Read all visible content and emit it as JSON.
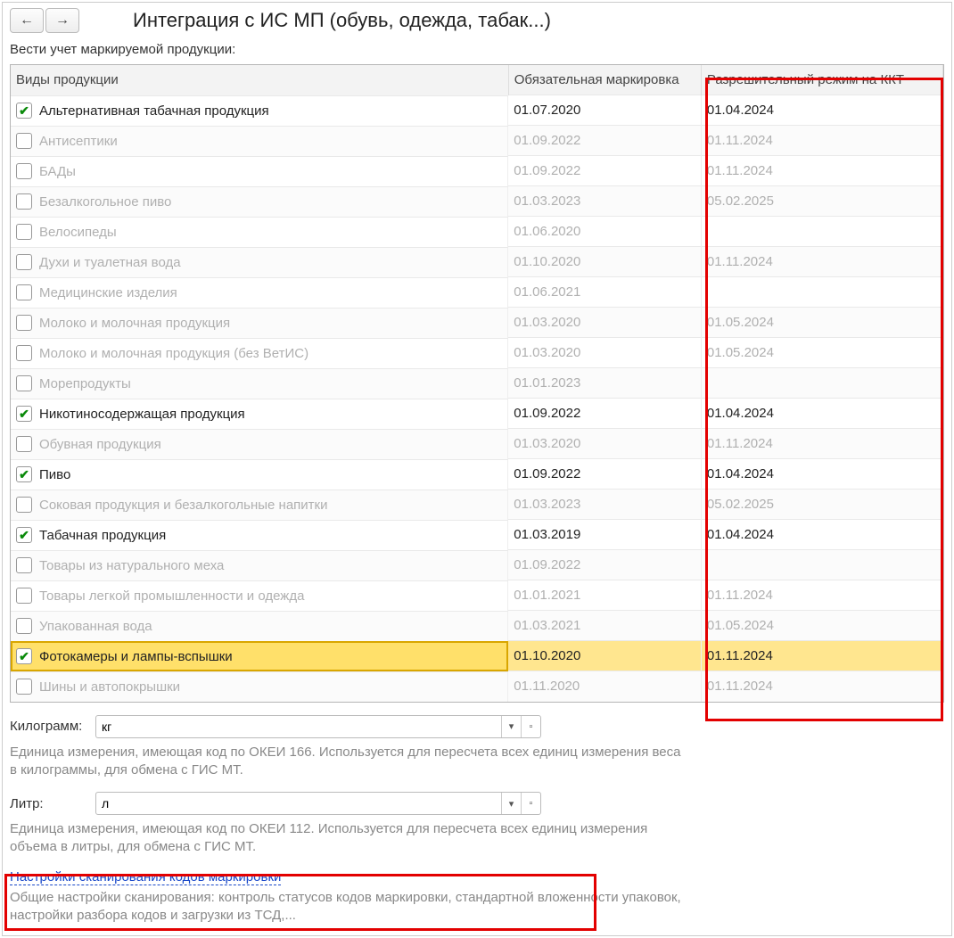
{
  "header": {
    "title": "Интеграция с ИС МП (обувь, одежда, табак...)"
  },
  "subtitle": "Вести учет маркируемой продукции:",
  "columns": {
    "name": "Виды продукции",
    "mandatory": "Обязательная маркировка",
    "kkt": "Разрешительный режим на ККТ"
  },
  "rows": [
    {
      "checked": true,
      "name": "Альтернативная табачная продукция",
      "mandatory": "01.07.2020",
      "kkt": "01.04.2024",
      "enabled": true,
      "selected": false
    },
    {
      "checked": false,
      "name": "Антисептики",
      "mandatory": "01.09.2022",
      "kkt": "01.11.2024",
      "enabled": false,
      "selected": false
    },
    {
      "checked": false,
      "name": "БАДы",
      "mandatory": "01.09.2022",
      "kkt": "01.11.2024",
      "enabled": false,
      "selected": false
    },
    {
      "checked": false,
      "name": "Безалкогольное пиво",
      "mandatory": "01.03.2023",
      "kkt": "05.02.2025",
      "enabled": false,
      "selected": false
    },
    {
      "checked": false,
      "name": "Велосипеды",
      "mandatory": "01.06.2020",
      "kkt": "",
      "enabled": false,
      "selected": false
    },
    {
      "checked": false,
      "name": "Духи и туалетная вода",
      "mandatory": "01.10.2020",
      "kkt": "01.11.2024",
      "enabled": false,
      "selected": false
    },
    {
      "checked": false,
      "name": "Медицинские изделия",
      "mandatory": "01.06.2021",
      "kkt": "",
      "enabled": false,
      "selected": false
    },
    {
      "checked": false,
      "name": "Молоко и молочная продукция",
      "mandatory": "01.03.2020",
      "kkt": "01.05.2024",
      "enabled": false,
      "selected": false
    },
    {
      "checked": false,
      "name": "Молоко и молочная продукция (без ВетИС)",
      "mandatory": "01.03.2020",
      "kkt": "01.05.2024",
      "enabled": false,
      "selected": false
    },
    {
      "checked": false,
      "name": "Морепродукты",
      "mandatory": "01.01.2023",
      "kkt": "",
      "enabled": false,
      "selected": false
    },
    {
      "checked": true,
      "name": "Никотиносодержащая продукция",
      "mandatory": "01.09.2022",
      "kkt": "01.04.2024",
      "enabled": true,
      "selected": false
    },
    {
      "checked": false,
      "name": "Обувная продукция",
      "mandatory": "01.03.2020",
      "kkt": "01.11.2024",
      "enabled": false,
      "selected": false
    },
    {
      "checked": true,
      "name": "Пиво",
      "mandatory": "01.09.2022",
      "kkt": "01.04.2024",
      "enabled": true,
      "selected": false
    },
    {
      "checked": false,
      "name": "Соковая продукция и безалкогольные напитки",
      "mandatory": "01.03.2023",
      "kkt": "05.02.2025",
      "enabled": false,
      "selected": false
    },
    {
      "checked": true,
      "name": "Табачная продукция",
      "mandatory": "01.03.2019",
      "kkt": "01.04.2024",
      "enabled": true,
      "selected": false
    },
    {
      "checked": false,
      "name": "Товары из натурального меха",
      "mandatory": "01.09.2022",
      "kkt": "",
      "enabled": false,
      "selected": false
    },
    {
      "checked": false,
      "name": "Товары легкой промышленности и одежда",
      "mandatory": "01.01.2021",
      "kkt": "01.11.2024",
      "enabled": false,
      "selected": false
    },
    {
      "checked": false,
      "name": "Упакованная вода",
      "mandatory": "01.03.2021",
      "kkt": "01.05.2024",
      "enabled": false,
      "selected": false
    },
    {
      "checked": true,
      "name": "Фотокамеры и лампы-вспышки",
      "mandatory": "01.10.2020",
      "kkt": "01.11.2024",
      "enabled": true,
      "selected": true
    },
    {
      "checked": false,
      "name": "Шины и автопокрышки",
      "mandatory": "01.11.2020",
      "kkt": "01.11.2024",
      "enabled": false,
      "selected": false
    }
  ],
  "kg": {
    "label": "Килограмм:",
    "value": "кг",
    "help": "Единица измерения, имеющая код по ОКЕИ 166. Используется для пересчета всех единиц измерения веса в килограммы, для обмена с ГИС МТ."
  },
  "liter": {
    "label": "Литр:",
    "value": "л",
    "help": "Единица измерения, имеющая код по ОКЕИ 112. Используется для пересчета всех единиц измерения объема в литры, для обмена с ГИС МТ."
  },
  "scan": {
    "link": "Настройки сканирования кодов маркировки",
    "help": "Общие настройки сканирования: контроль статусов кодов маркировки, стандартной вложенности упаковок, настройки разбора кодов и загрузки из ТСД,..."
  }
}
